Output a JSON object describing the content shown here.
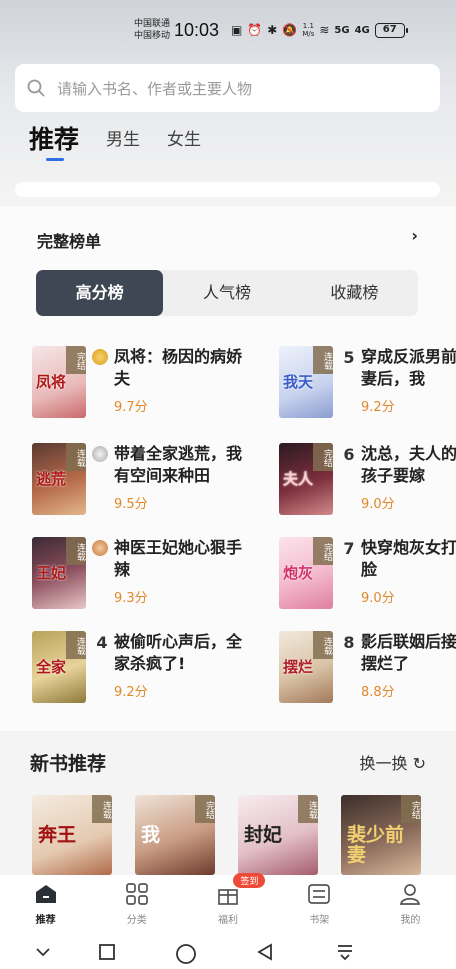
{
  "status": {
    "carrier1": "中国联通",
    "carrier2": "中国移动",
    "time": "10:03",
    "speed_value": "1.1",
    "speed_unit": "M/s",
    "net1": "5G",
    "net2": "4G",
    "battery": "67"
  },
  "search": {
    "placeholder": "请输入书名、作者或主要人物"
  },
  "tabs": [
    "推荐",
    "男生",
    "女生"
  ],
  "ranking": {
    "title": "完整榜单",
    "segments": [
      "高分榜",
      "人气榜",
      "收藏榜"
    ],
    "books": [
      {
        "rank": "1",
        "title": "凤将：杨因的病娇夫",
        "score": "9.7分",
        "status": "完结",
        "cover_text": "凤将"
      },
      {
        "rank": "2",
        "title": "带着全家逃荒，我有空间来种田",
        "score": "9.5分",
        "status": "连载",
        "cover_text": "逃荒"
      },
      {
        "rank": "3",
        "title": "神医王妃她心狠手辣",
        "score": "9.3分",
        "status": "连载",
        "cover_text": "王妃"
      },
      {
        "rank": "4",
        "title": "被偷听心声后，全家杀疯了!",
        "score": "9.2分",
        "status": "连载",
        "cover_text": "全家"
      },
      {
        "rank": "5",
        "title": "穿成反派男前妻后，我",
        "score": "9.2分",
        "status": "连载",
        "cover_text": "我天"
      },
      {
        "rank": "6",
        "title": "沈总，夫人的孩子要嫁",
        "score": "9.0分",
        "status": "完结",
        "cover_text": "夫人"
      },
      {
        "rank": "7",
        "title": "快穿炮灰女打脸",
        "score": "9.0分",
        "status": "完结",
        "cover_text": "炮灰"
      },
      {
        "rank": "8",
        "title": "影后联姻后接摆烂了",
        "score": "8.8分",
        "status": "连载",
        "cover_text": "摆烂"
      }
    ]
  },
  "new_books": {
    "title": "新书推荐",
    "refresh_label": "换一换",
    "items": [
      {
        "status": "连载",
        "cover_text": "奔王"
      },
      {
        "status": "完结",
        "cover_text": "我"
      },
      {
        "status": "连载",
        "cover_text": "封妃"
      },
      {
        "status": "完结",
        "cover_text": "裴少前妻"
      }
    ]
  },
  "nav": [
    "推荐",
    "分类",
    "福利",
    "书架",
    "我的"
  ],
  "nav_badge": "签到",
  "colors": {
    "accent": "#2f6fe6",
    "score": "#e0892a",
    "segment_active": "#3e4753",
    "badge": "#ee4a3a"
  }
}
